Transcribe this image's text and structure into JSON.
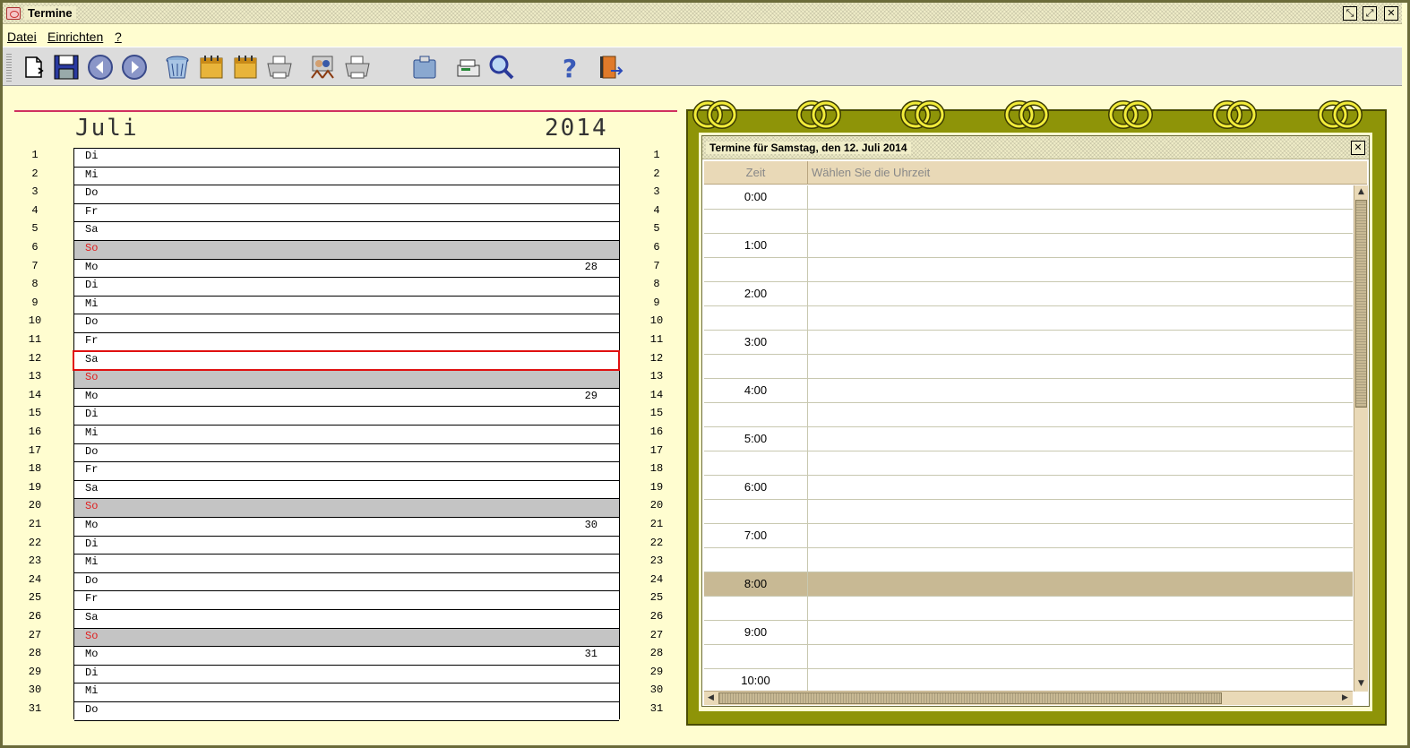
{
  "window": {
    "title": "Termine",
    "controls": [
      "⤡",
      "⤢",
      "✕"
    ]
  },
  "menu": [
    {
      "label": "Datei"
    },
    {
      "label": "Einrichten"
    },
    {
      "label": "?"
    }
  ],
  "toolbar": {
    "icons": [
      "new-document-icon",
      "save-icon",
      "back-icon",
      "forward-icon",
      "trash-icon",
      "calendar-icon",
      "calendar-copy-icon",
      "print-icon",
      "users-icon",
      "print-preview-icon",
      "clipboard-icon",
      "fax-icon",
      "search-icon",
      "help-icon",
      "exit-icon"
    ]
  },
  "calendar": {
    "month": "Juli",
    "year": "2014",
    "selected_day": 12,
    "days": [
      {
        "num": "1",
        "name": "Di",
        "kw": ""
      },
      {
        "num": "2",
        "name": "Mi",
        "kw": ""
      },
      {
        "num": "3",
        "name": "Do",
        "kw": ""
      },
      {
        "num": "4",
        "name": "Fr",
        "kw": ""
      },
      {
        "num": "5",
        "name": "Sa",
        "kw": ""
      },
      {
        "num": "6",
        "name": "So",
        "kw": ""
      },
      {
        "num": "7",
        "name": "Mo",
        "kw": "28"
      },
      {
        "num": "8",
        "name": "Di",
        "kw": ""
      },
      {
        "num": "9",
        "name": "Mi",
        "kw": ""
      },
      {
        "num": "10",
        "name": "Do",
        "kw": ""
      },
      {
        "num": "11",
        "name": "Fr",
        "kw": ""
      },
      {
        "num": "12",
        "name": "Sa",
        "kw": ""
      },
      {
        "num": "13",
        "name": "So",
        "kw": ""
      },
      {
        "num": "14",
        "name": "Mo",
        "kw": "29"
      },
      {
        "num": "15",
        "name": "Di",
        "kw": ""
      },
      {
        "num": "16",
        "name": "Mi",
        "kw": ""
      },
      {
        "num": "17",
        "name": "Do",
        "kw": ""
      },
      {
        "num": "18",
        "name": "Fr",
        "kw": ""
      },
      {
        "num": "19",
        "name": "Sa",
        "kw": ""
      },
      {
        "num": "20",
        "name": "So",
        "kw": ""
      },
      {
        "num": "21",
        "name": "Mo",
        "kw": "30"
      },
      {
        "num": "22",
        "name": "Di",
        "kw": ""
      },
      {
        "num": "23",
        "name": "Mi",
        "kw": ""
      },
      {
        "num": "24",
        "name": "Do",
        "kw": ""
      },
      {
        "num": "25",
        "name": "Fr",
        "kw": ""
      },
      {
        "num": "26",
        "name": "Sa",
        "kw": ""
      },
      {
        "num": "27",
        "name": "So",
        "kw": ""
      },
      {
        "num": "28",
        "name": "Mo",
        "kw": "31"
      },
      {
        "num": "29",
        "name": "Di",
        "kw": ""
      },
      {
        "num": "30",
        "name": "Mi",
        "kw": ""
      },
      {
        "num": "31",
        "name": "Do",
        "kw": ""
      }
    ]
  },
  "appointments": {
    "title": "Termine für Samstag, den 12. Juli 2014",
    "close": "✕",
    "col_time": "Zeit",
    "col_desc": "Wählen Sie die Uhrzeit",
    "selected_slot": "8:00",
    "slots": [
      "0:00",
      "",
      "1:00",
      "",
      "2:00",
      "",
      "3:00",
      "",
      "4:00",
      "",
      "5:00",
      "",
      "6:00",
      "",
      "7:00",
      "",
      "8:00",
      "",
      "9:00",
      "",
      "10:00"
    ],
    "scroll": {
      "up": "▲",
      "down": "▼",
      "left": "◀",
      "right": "▶"
    }
  },
  "colors": {
    "background": "#fffdd0",
    "olive": "#8e9408",
    "sunday_text": "#e02020",
    "sunday_row": "#c4c4c4",
    "selection": "#e01010",
    "selected_slot": "#c8b994"
  }
}
